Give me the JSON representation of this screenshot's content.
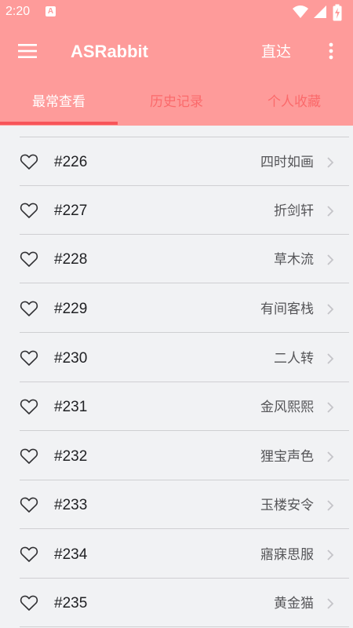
{
  "status_bar": {
    "time": "2:20",
    "notification_badge": "A"
  },
  "app_bar": {
    "title": "ASRabbit",
    "direct_label": "直达"
  },
  "tabs": [
    {
      "label": "最常查看",
      "active": true
    },
    {
      "label": "历史记录",
      "active": false
    },
    {
      "label": "个人收藏",
      "active": false
    }
  ],
  "items": [
    {
      "number": "#226",
      "name": "四时如画"
    },
    {
      "number": "#227",
      "name": "折剑轩"
    },
    {
      "number": "#228",
      "name": "草木流"
    },
    {
      "number": "#229",
      "name": "有间客栈"
    },
    {
      "number": "#230",
      "name": "二人转"
    },
    {
      "number": "#231",
      "name": "金风熙熙"
    },
    {
      "number": "#232",
      "name": "狸宝声色"
    },
    {
      "number": "#233",
      "name": "玉楼安令"
    },
    {
      "number": "#234",
      "name": "寤寐思服"
    },
    {
      "number": "#235",
      "name": "黄金猫"
    }
  ],
  "colors": {
    "header_bg": "#fe9b9a",
    "tab_indicator": "#f7555a",
    "inactive_tab_text": "#fb6a6b",
    "list_bg": "#f1f2f4"
  },
  "icons": {
    "menu": "menu-icon",
    "more": "more-vertical-icon",
    "favorite": "heart-outline-icon",
    "chevron": "chevron-right-icon",
    "wifi": "wifi-icon",
    "signal": "signal-icon",
    "battery": "battery-charging-icon"
  }
}
